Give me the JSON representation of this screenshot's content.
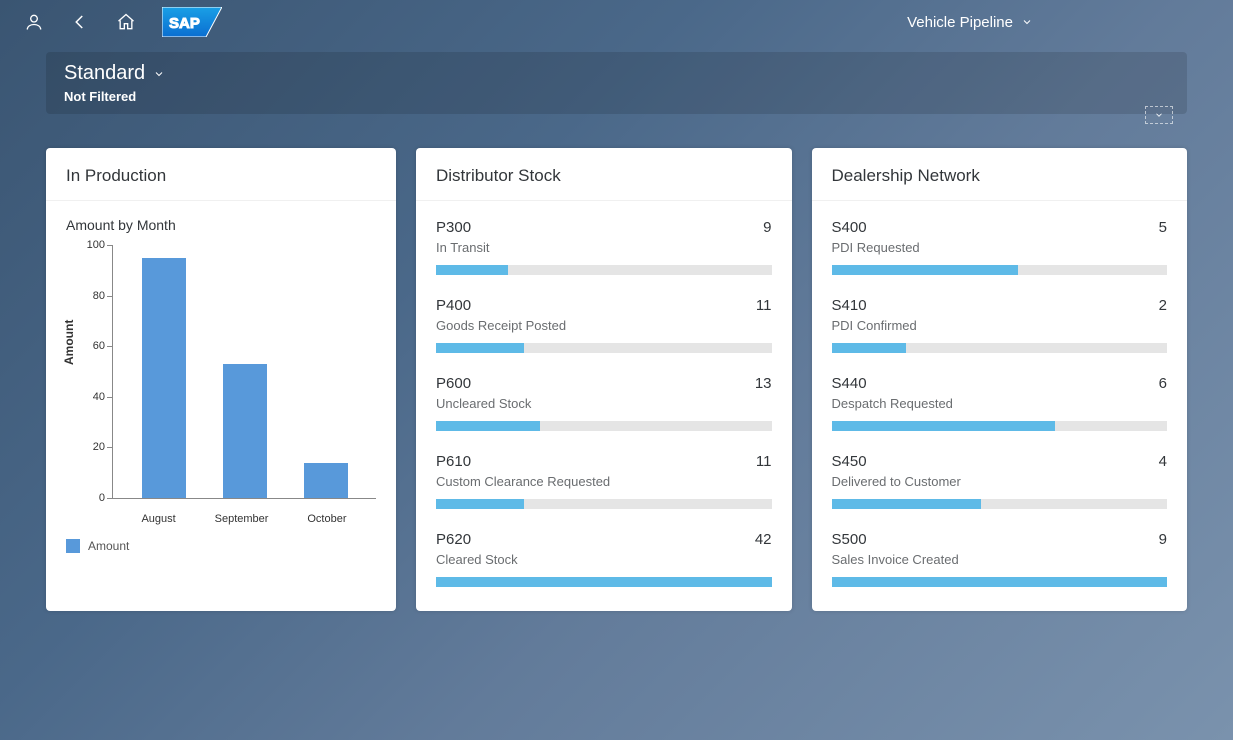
{
  "header": {
    "app_title": "Vehicle Pipeline",
    "logo_text": "SAP"
  },
  "filter": {
    "variant": "Standard",
    "status": "Not Filtered"
  },
  "cards": {
    "production": {
      "title": "In Production",
      "chart_subtitle": "Amount by Month"
    },
    "distributor": {
      "title": "Distributor Stock",
      "items": [
        {
          "code": "P300",
          "desc": "In Transit",
          "value": 9
        },
        {
          "code": "P400",
          "desc": "Goods Receipt Posted",
          "value": 11
        },
        {
          "code": "P600",
          "desc": "Uncleared Stock",
          "value": 13
        },
        {
          "code": "P610",
          "desc": "Custom Clearance Requested",
          "value": 11
        },
        {
          "code": "P620",
          "desc": "Cleared Stock",
          "value": 42
        }
      ]
    },
    "dealership": {
      "title": "Dealership Network",
      "items": [
        {
          "code": "S400",
          "desc": "PDI Requested",
          "value": 5
        },
        {
          "code": "S410",
          "desc": "PDI Confirmed",
          "value": 2
        },
        {
          "code": "S440",
          "desc": "Despatch Requested",
          "value": 6
        },
        {
          "code": "S450",
          "desc": "Delivered to Customer",
          "value": 4
        },
        {
          "code": "S500",
          "desc": "Sales Invoice Created",
          "value": 9
        }
      ]
    }
  },
  "chart_data": {
    "type": "bar",
    "title": "Amount by Month",
    "ylabel": "Amount",
    "xlabel": "",
    "ylim": [
      0,
      100
    ],
    "yticks": [
      0,
      20,
      40,
      60,
      80,
      100
    ],
    "categories": [
      "August",
      "September",
      "October"
    ],
    "values": [
      95,
      53,
      14
    ],
    "legend": "Amount",
    "series_color": "#5899da"
  }
}
